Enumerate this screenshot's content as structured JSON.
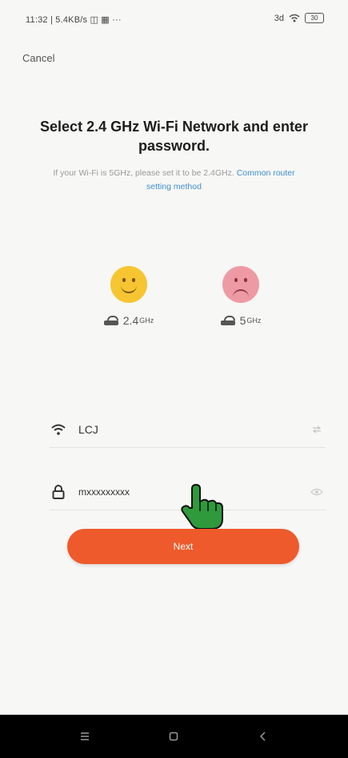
{
  "status_bar": {
    "left_text": "11:32 | 5.4KB/s ◫ ▦ ···",
    "right_text": "3d",
    "battery": "30"
  },
  "header": {
    "cancel_label": "Cancel"
  },
  "main": {
    "title": "Select 2.4 GHz Wi-Fi Network and enter password.",
    "subtitle": "If your Wi-Fi is 5GHz, please set it to be 2.4GHz.",
    "subtitle_link": "Common router setting method"
  },
  "bands": [
    {
      "label": "2.4",
      "unit": "GHz",
      "status": "supported",
      "face": "smile-icon"
    },
    {
      "label": "5",
      "unit": "GHz",
      "status": "unsupported",
      "face": "sad-icon"
    }
  ],
  "form": {
    "wifi_name": "LCJ",
    "password": "mxxxxxxxxx"
  },
  "actions": {
    "next_label": "Next"
  },
  "colors": {
    "accent": "#ee5a2b",
    "link": "#3f8fd0",
    "good_face": "#f6c531",
    "bad_face": "#ee9aa4",
    "hand": "#2f9a3c"
  }
}
